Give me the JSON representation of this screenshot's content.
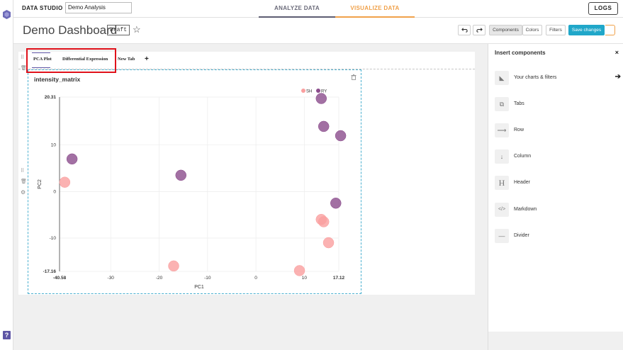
{
  "app": {
    "brand": "DATA STUDIO",
    "project_value": "Demo Analysis",
    "help_label": "?"
  },
  "nav": {
    "tabs": [
      {
        "label": "ANALYZE DATA",
        "color": "#6b6b7a"
      },
      {
        "label": "VISUALIZE DATA",
        "color": "#f0a14a"
      }
    ],
    "logs_label": "LOGS"
  },
  "header": {
    "title": "Demo Dashboard",
    "status": "Draft",
    "star_icon": "star-outline-icon",
    "undo_icon": "undo-icon",
    "redo_icon": "redo-icon",
    "buttons": {
      "components": "Components",
      "colors": "Colors",
      "filters": "Filters",
      "save": "Save changes"
    },
    "accent": "#20a7c9"
  },
  "dashboard": {
    "tabs": [
      {
        "label": "PCA Plot"
      },
      {
        "label": "Differential Expression"
      },
      {
        "label": "New Tab"
      }
    ],
    "add_tab": "+",
    "chart": {
      "title": "intensity_matrix",
      "trash_icon": "trash-icon"
    }
  },
  "chart_data": {
    "type": "scatter",
    "title": "intensity_matrix",
    "xlabel": "PC1",
    "ylabel": "PC2",
    "xlim": [
      -40.58,
      17.12
    ],
    "ylim": [
      -17.16,
      20.31
    ],
    "x_ticks": [
      "-40.58",
      "-30",
      "-20",
      "-10",
      "0",
      "10",
      "17.12"
    ],
    "y_ticks": [
      "20.31",
      "10",
      "0",
      "-10",
      "-17.16"
    ],
    "legend_position": "top-right",
    "grid": true,
    "series": [
      {
        "name": "SH",
        "color": "#fa9f9f",
        "points": [
          {
            "x": -39.5,
            "y": 2.0
          },
          {
            "x": -17.0,
            "y": -16.0
          },
          {
            "x": 9.0,
            "y": -17.0
          },
          {
            "x": 13.5,
            "y": -6.0
          },
          {
            "x": 14.0,
            "y": -6.5
          },
          {
            "x": 15.0,
            "y": -11.0
          }
        ]
      },
      {
        "name": "RY",
        "color": "#8b4c8c",
        "points": [
          {
            "x": -38.0,
            "y": 7.0
          },
          {
            "x": -15.5,
            "y": 3.5
          },
          {
            "x": 13.5,
            "y": 20.0
          },
          {
            "x": 14.0,
            "y": 14.0
          },
          {
            "x": 17.5,
            "y": 12.0
          },
          {
            "x": 16.5,
            "y": -2.5
          }
        ]
      }
    ]
  },
  "panel": {
    "title": "Insert components",
    "close_label": "×",
    "items": [
      {
        "label": "Your charts & filters",
        "icon": "chart-area-icon",
        "glyph": "◣",
        "arrow": "➔"
      },
      {
        "label": "Tabs",
        "icon": "tabs-icon",
        "glyph": "⧉"
      },
      {
        "label": "Row",
        "icon": "row-arrow-icon",
        "glyph": "⟶"
      },
      {
        "label": "Column",
        "icon": "column-arrow-icon",
        "glyph": "↓"
      },
      {
        "label": "Header",
        "icon": "header-h-icon",
        "glyph": "H"
      },
      {
        "label": "Markdown",
        "icon": "code-icon",
        "glyph": "</>"
      },
      {
        "label": "Divider",
        "icon": "divider-icon",
        "glyph": "—"
      }
    ]
  }
}
